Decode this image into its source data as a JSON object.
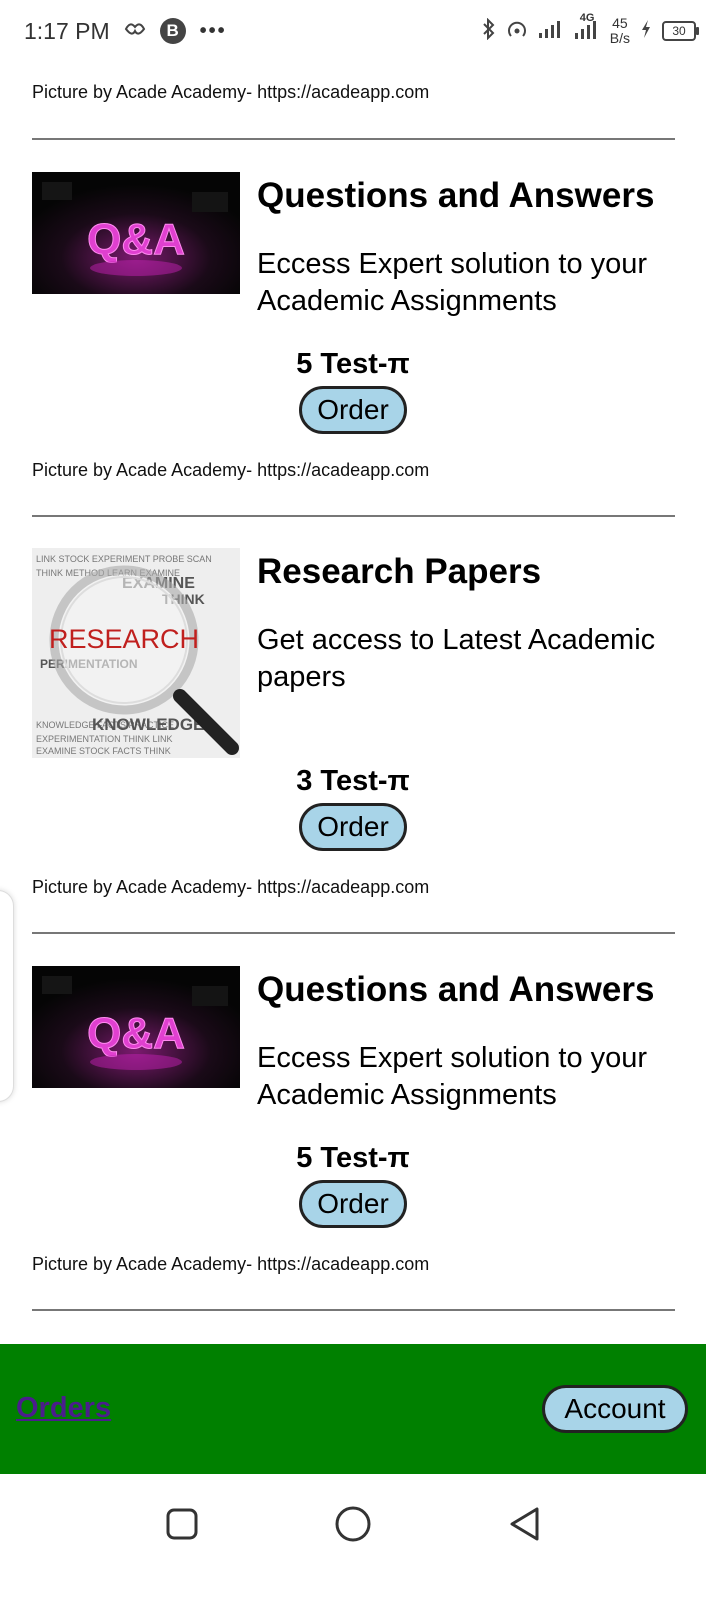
{
  "status_bar": {
    "time": "1:17 PM",
    "badge": "B",
    "more": "•••",
    "network": "4G",
    "speed_value": "45",
    "speed_unit": "B/s",
    "battery": "30"
  },
  "top_credit": "Picture by Acade Academy- https://acadeapp.com",
  "cards": [
    {
      "title": "Questions and Answers",
      "description": "Eccess Expert solution to your Academic Assignments",
      "price": "5 Test-π",
      "order_label": "Order",
      "credit": "Picture by Acade Academy- https://acadeapp.com",
      "image_text": "Q&A"
    },
    {
      "title": "Research Papers",
      "description": "Get access to Latest Academic papers",
      "price": "3 Test-π",
      "order_label": "Order",
      "credit": "Picture by Acade Academy- https://acadeapp.com",
      "image_text": "RESEARCH"
    },
    {
      "title": "Questions and Answers",
      "description": "Eccess Expert solution to your Academic Assignments",
      "price": "5 Test-π",
      "order_label": "Order",
      "credit": "Picture by Acade Academy- https://acadeapp.com",
      "image_text": "Q&A"
    }
  ],
  "bottom_bar": {
    "orders_label": "Orders",
    "account_label": "Account"
  },
  "colors": {
    "bottom_bar": "#008000",
    "button_fill": "#a8d4e8",
    "orders_link": "#4b1d8c"
  }
}
